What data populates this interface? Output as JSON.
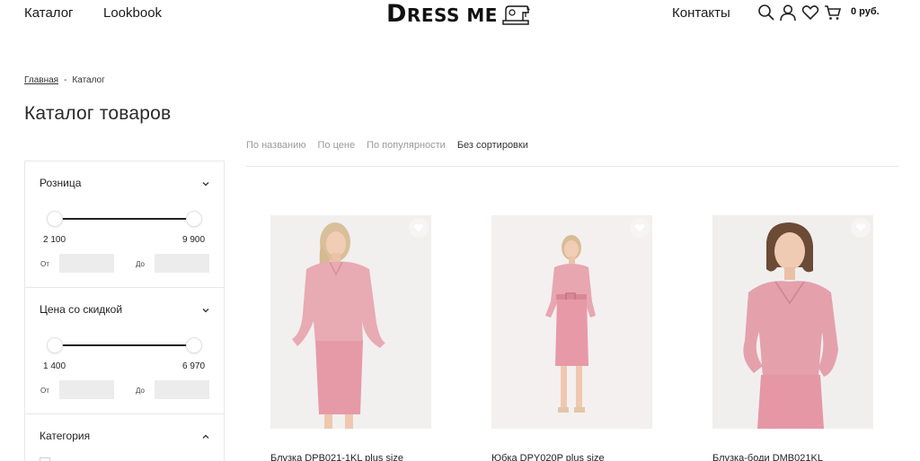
{
  "header": {
    "nav": [
      "Каталог",
      "Lookbook"
    ],
    "logo_text": "DRESS ME",
    "contacts": "Контакты",
    "cart_total": "0 руб.",
    "icons": [
      "search-icon",
      "user-icon",
      "heart-icon",
      "cart-icon"
    ]
  },
  "breadcrumb": {
    "home": "Главная",
    "separator": "-",
    "current": "Каталог"
  },
  "page_title": "Каталог товаров",
  "sort": {
    "options": [
      "По названию",
      "По цене",
      "По популярности",
      "Без сортировки"
    ],
    "active_index": 3
  },
  "filters": {
    "retail": {
      "title": "Розница",
      "min_value": "2 100",
      "max_value": "9 900",
      "from_label": "От",
      "to_label": "До",
      "from_value": "",
      "to_value": ""
    },
    "discount": {
      "title": "Цена со скидкой",
      "min_value": "1 400",
      "max_value": "6 970",
      "from_label": "От",
      "to_label": "До",
      "from_value": "",
      "to_value": ""
    },
    "category": {
      "title": "Категория"
    }
  },
  "products": [
    {
      "name": "Блузка DPB021-1KL plus size"
    },
    {
      "name": "Юбка DPY020P plus size"
    },
    {
      "name": "Блузка-боди DMB021KL"
    }
  ],
  "colors": {
    "sort_inactive": "#9a9a9a",
    "input_bg": "#ececec",
    "product_pink": "#e8a2ad"
  }
}
